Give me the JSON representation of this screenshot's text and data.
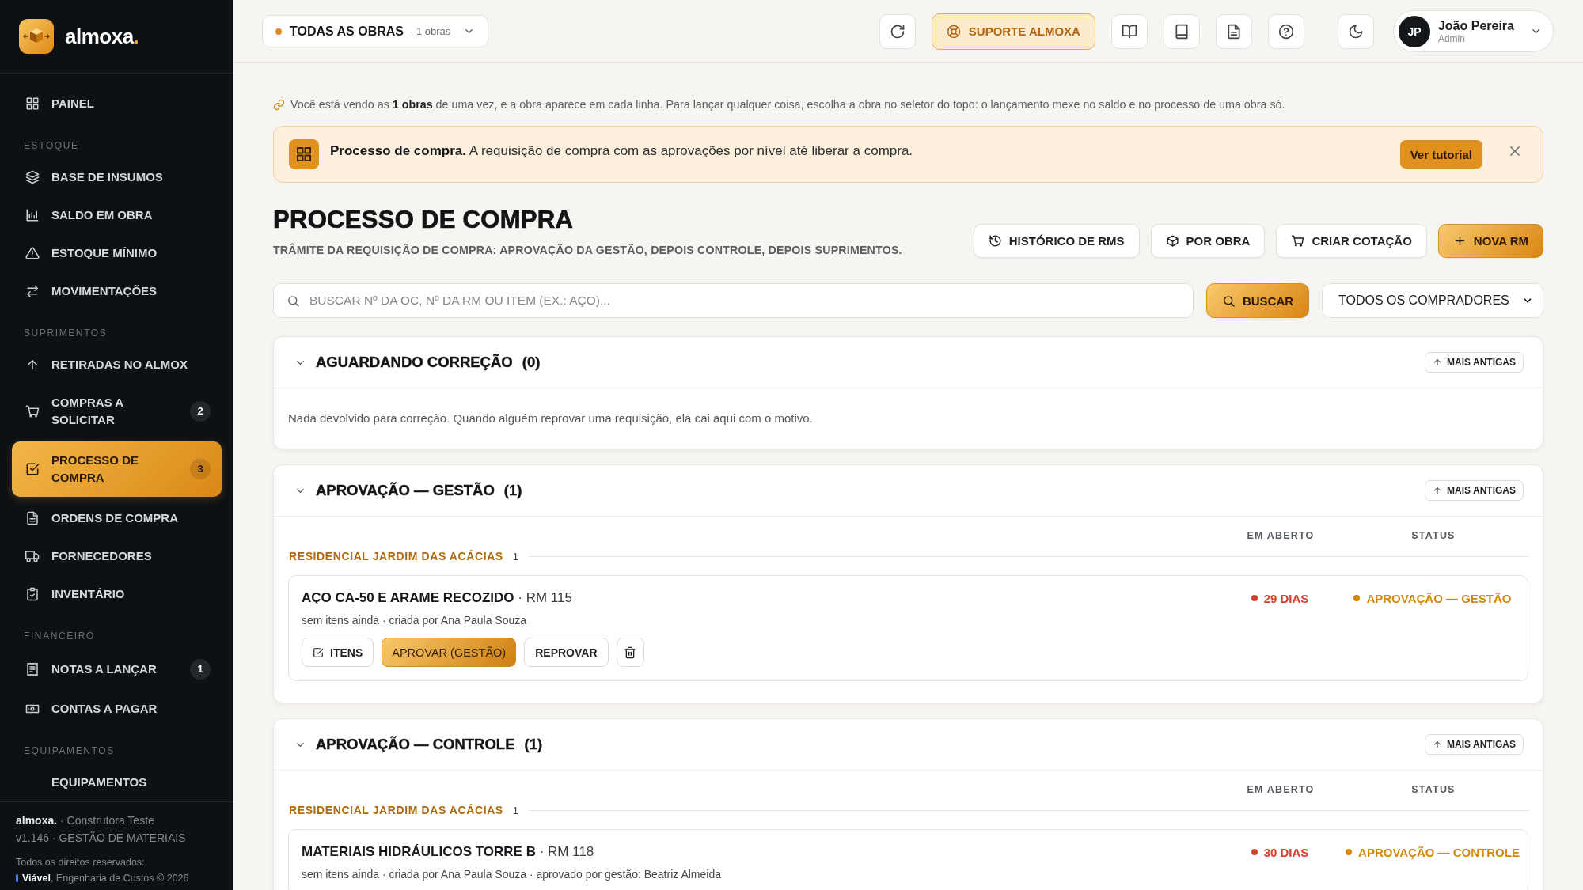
{
  "sidebar": {
    "brand": {
      "name": "almoxa",
      "dot": "."
    },
    "sections": [
      {
        "items": [
          {
            "label": "PAINEL",
            "selected": false
          }
        ]
      },
      {
        "title": "ESTOQUE",
        "items": [
          {
            "label": "BASE DE INSUMOS",
            "selected": false
          },
          {
            "label": "SALDO EM OBRA",
            "selected": false
          },
          {
            "label": "ESTOQUE MÍNIMO",
            "selected": false
          },
          {
            "label": "MOVIMENTAÇÕES",
            "selected": false
          }
        ]
      },
      {
        "title": "SUPRIMENTOS",
        "items": [
          {
            "label": "RETIRADAS NO ALMOX",
            "selected": false
          },
          {
            "label": "COMPRAS A SOLICITAR",
            "selected": false,
            "badge": "2"
          },
          {
            "label": "PROCESSO DE COMPRA",
            "selected": true,
            "badge": "3"
          },
          {
            "label": "ORDENS DE COMPRA",
            "selected": false
          },
          {
            "label": "FORNECEDORES",
            "selected": false
          },
          {
            "label": "INVENTÁRIO",
            "selected": false
          }
        ]
      },
      {
        "title": "FINANCEIRO",
        "items": [
          {
            "label": "NOTAS A LANÇAR",
            "selected": false,
            "badge": "1"
          },
          {
            "label": "CONTAS A PAGAR",
            "selected": false
          }
        ]
      },
      {
        "title": "EQUIPAMENTOS",
        "items": [
          {
            "label": "EQUIPAMENTOS",
            "selected": false
          }
        ]
      }
    ],
    "footer": {
      "company": "**almoxa.** · Construtora Teste",
      "version": "v1.146 · GESTÃO DE MATERIAIS",
      "rights": "Todos os direitos reservados:",
      "credit": "**Viável**, Engenharia de Custos © 2026"
    }
  },
  "topbar": {
    "site_selector": {
      "label": "TODAS AS OBRAS",
      "count": "· 1 obras"
    },
    "support_button": "SUPORTE ALMOXA",
    "user": {
      "initials": "JP",
      "name": "João Pereira",
      "role": "Admin"
    }
  },
  "notice": "Você está vendo as **1 obras** de uma vez, e a obra aparece em cada linha. Para lançar qualquer coisa, escolha a obra no seletor do topo: o lançamento mexe no saldo e no processo de uma obra só.",
  "banner": {
    "text": "**Processo de compra.** A requisição de compra com as aprovações por nível até liberar a compra.",
    "button": "Ver tutorial"
  },
  "page": {
    "title": "PROCESSO DE COMPRA",
    "subtitle": "TRÂMITE DA REQUISIÇÃO DE COMPRA: APROVAÇÃO DA GESTÃO, DEPOIS CONTROLE, DEPOIS SUPRIMENTOS.",
    "actions": [
      {
        "label": "HISTÓRICO DE RMS",
        "kind": "outline"
      },
      {
        "label": "POR OBRA",
        "kind": "outline"
      },
      {
        "label": "CRIAR COTAÇÃO",
        "kind": "outline"
      },
      {
        "label": "NOVA RM",
        "kind": "primary"
      }
    ]
  },
  "search": {
    "placeholder": "BUSCAR Nº DA OC, Nº DA RM OU ITEM (EX.: AÇO)...",
    "button": "BUSCAR",
    "buyer_filter": "TODOS OS COMPRADORES"
  },
  "stages": [
    {
      "title": "AGUARDANDO CORREÇÃO",
      "count": "(0)",
      "expanded": true,
      "sort_button": "MAIS ANTIGAS",
      "empty_text": "Nada devolvido para correção. Quando alguém reprovar uma requisição, ela cai aqui com o motivo."
    },
    {
      "title": "APROVAÇÃO — GESTÃO",
      "count": "(1)",
      "expanded": true,
      "sort_button": "MAIS ANTIGAS",
      "columns": [
        "EM ABERTO",
        "STATUS"
      ],
      "groups": [
        {
          "name": "RESIDENCIAL JARDIM DAS ACÁCIAS",
          "count": "1",
          "requests": [
            {
              "title": "**AÇO CA-50 E ARAME RECOZIDO** · RM 115",
              "meta": "sem itens ainda · criada por Ana Paula Souza",
              "age": "29 DIAS",
              "status": "APROVAÇÃO — GESTÃO",
              "actions": [
                {
                  "label": "ITENS",
                  "kind": "checklist"
                },
                {
                  "label": "APROVAR (GESTÃO)",
                  "kind": "primary"
                },
                {
                  "label": "REPROVAR",
                  "kind": "plain"
                },
                {
                  "kind": "delete"
                }
              ]
            }
          ]
        }
      ]
    },
    {
      "title": "APROVAÇÃO — CONTROLE",
      "count": "(1)",
      "expanded": true,
      "sort_button": "MAIS ANTIGAS",
      "columns": [
        "EM ABERTO",
        "STATUS"
      ],
      "groups": [
        {
          "name": "RESIDENCIAL JARDIM DAS ACÁCIAS",
          "count": "1",
          "requests": [
            {
              "title": "**MATERIAIS HIDRÁULICOS TORRE B** · RM 118",
              "meta": "sem itens ainda · criada por Ana Paula Souza · aprovado por gestão: Beatriz Almeida",
              "age": "30 DIAS",
              "status": "APROVAÇÃO — CONTROLE"
            }
          ]
        }
      ]
    }
  ]
}
